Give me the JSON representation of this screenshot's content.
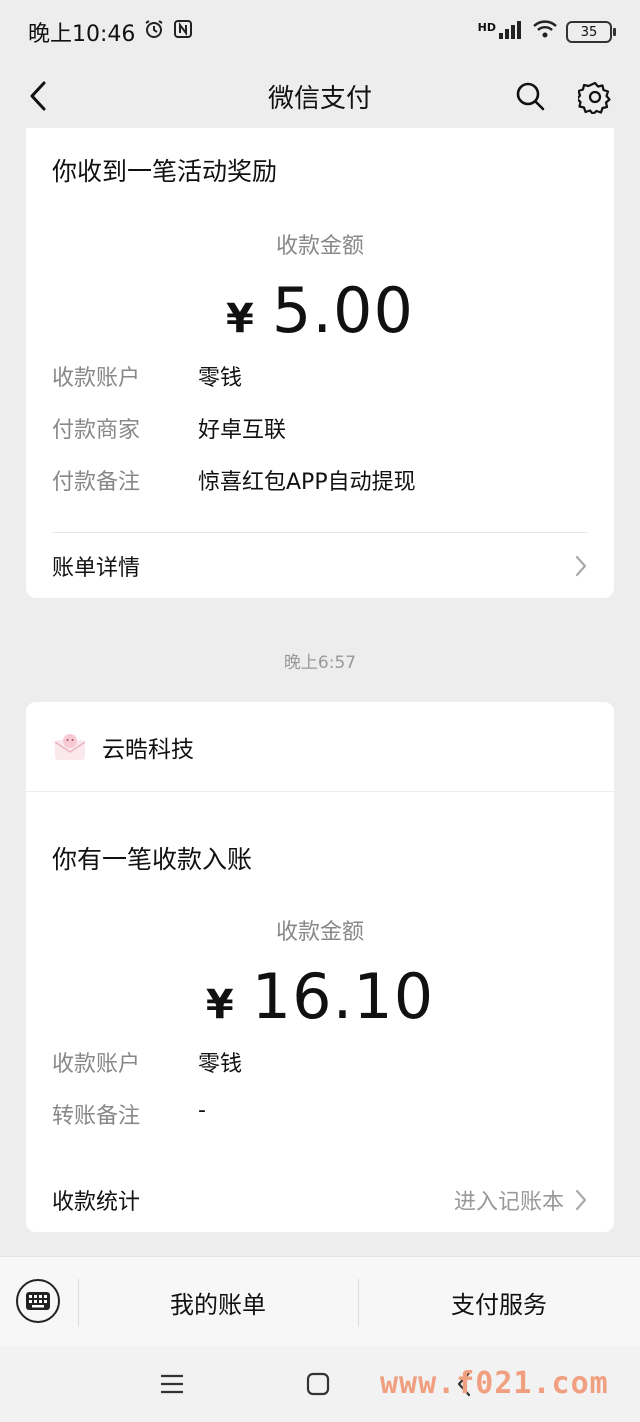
{
  "status_bar": {
    "time": "晚上10:46",
    "network_label": "HD",
    "battery": "35"
  },
  "nav": {
    "title": "微信支付"
  },
  "card1": {
    "title": "你收到一笔活动奖励",
    "amount_label": "收款金额",
    "currency": "¥",
    "amount": "5.00",
    "rows": [
      {
        "key": "收款账户",
        "value": "零钱"
      },
      {
        "key": "付款商家",
        "value": "好卓互联"
      },
      {
        "key": "付款备注",
        "value": "惊喜红包APP自动提现"
      }
    ],
    "link_label": "账单详情"
  },
  "timestamp": "晚上6:57",
  "card2": {
    "merchant": "云晧科技",
    "title": "你有一笔收款入账",
    "amount_label": "收款金额",
    "currency": "¥",
    "amount": "16.10",
    "rows": [
      {
        "key": "收款账户",
        "value": "零钱"
      },
      {
        "key": "转账备注",
        "value": "-"
      }
    ],
    "link_label": "收款统计",
    "link_right": "进入记账本"
  },
  "bottom_bar": {
    "tab1": "我的账单",
    "tab2": "支付服务"
  },
  "watermark": "www.f021.com"
}
